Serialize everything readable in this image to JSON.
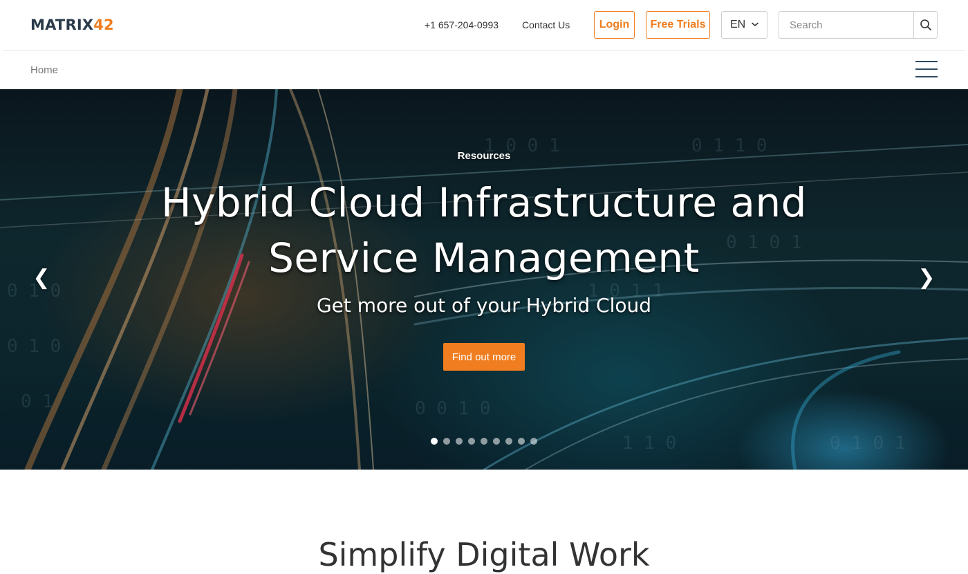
{
  "brand": {
    "logo_word": "MATRIX",
    "logo_num": "42",
    "accent_color": "#f07d1f",
    "dark_color": "#2a3a4a"
  },
  "header": {
    "phone": "+1 657-204-0993",
    "contact_label": "Contact Us",
    "login_label": "Login",
    "trials_label": "Free Trials",
    "language": "EN",
    "search_placeholder": "Search",
    "search_icon": "search-icon"
  },
  "breadcrumb": {
    "home": "Home"
  },
  "hero": {
    "kicker": "Resources",
    "title": "Hybrid Cloud Infrastructure and Service Management",
    "subtitle": "Get more out of your Hybrid Cloud",
    "cta_label": "Find out more",
    "prev_arrow": "❮",
    "next_arrow": "❯",
    "slide_count": 9,
    "active_slide": 1
  },
  "section": {
    "title": "Simplify Digital Work"
  }
}
